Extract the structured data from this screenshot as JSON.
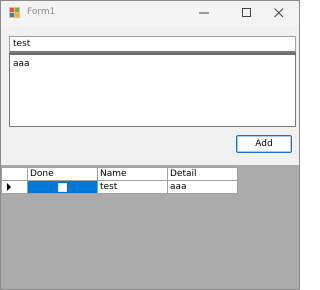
{
  "window": {
    "title": "Form1"
  },
  "form": {
    "name_value": "test",
    "detail_value": "aaa",
    "add_label": "Add"
  },
  "grid": {
    "columns": [
      "Done",
      "Name",
      "Detail"
    ],
    "rows": [
      {
        "done": false,
        "name": "test",
        "detail": "aaa"
      }
    ]
  },
  "colors": {
    "accent": "#0078d7",
    "button_border": "#1f6fd6",
    "grid_background": "#ababab"
  },
  "icons": {
    "app": "windows-form-icon",
    "minimize": "minimize-icon",
    "maximize": "maximize-icon",
    "close": "close-icon",
    "current_row": "row-pointer-icon"
  }
}
